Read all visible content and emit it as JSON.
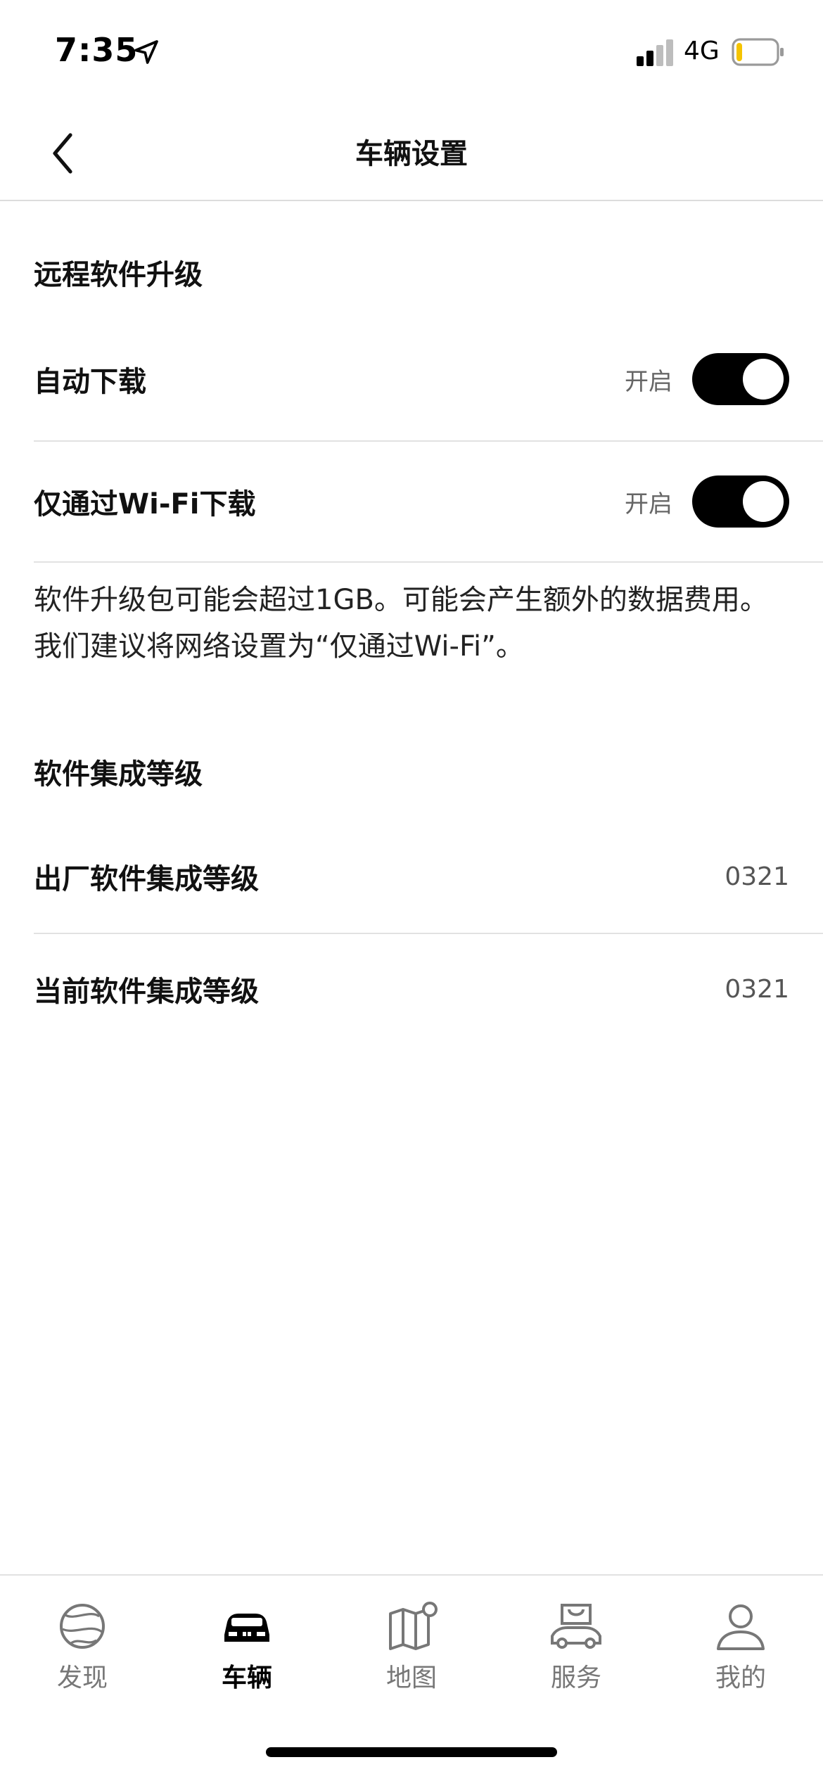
{
  "status_bar": {
    "time": "7:35",
    "network": "4G",
    "battery_color": "#f5c400"
  },
  "header": {
    "title": "车辆设置"
  },
  "ota_section": {
    "title": "远程软件升级",
    "rows": [
      {
        "label": "自动下载",
        "state": "开启",
        "enabled": true
      },
      {
        "label": "仅通过Wi-Fi下载",
        "state": "开启",
        "enabled": true
      }
    ],
    "note": "软件升级包可能会超过1GB。可能会产生额外的数据费用。我们建议将网络设置为“仅通过Wi-Fi”。"
  },
  "integration_section": {
    "title": "软件集成等级",
    "rows": [
      {
        "label": "出厂软件集成等级",
        "value": "0321"
      },
      {
        "label": "当前软件集成等级",
        "value": "0321"
      }
    ]
  },
  "tab_bar": {
    "tabs": [
      {
        "label": "发现",
        "icon": "globe-icon",
        "active": false
      },
      {
        "label": "车辆",
        "icon": "car-icon",
        "active": true
      },
      {
        "label": "地图",
        "icon": "map-icon",
        "active": false
      },
      {
        "label": "服务",
        "icon": "service-icon",
        "active": false
      },
      {
        "label": "我的",
        "icon": "user-icon",
        "active": false
      }
    ]
  },
  "colors": {
    "toggle_on": "#000000",
    "active_tab": "#000000",
    "inactive_tab": "#777777"
  }
}
